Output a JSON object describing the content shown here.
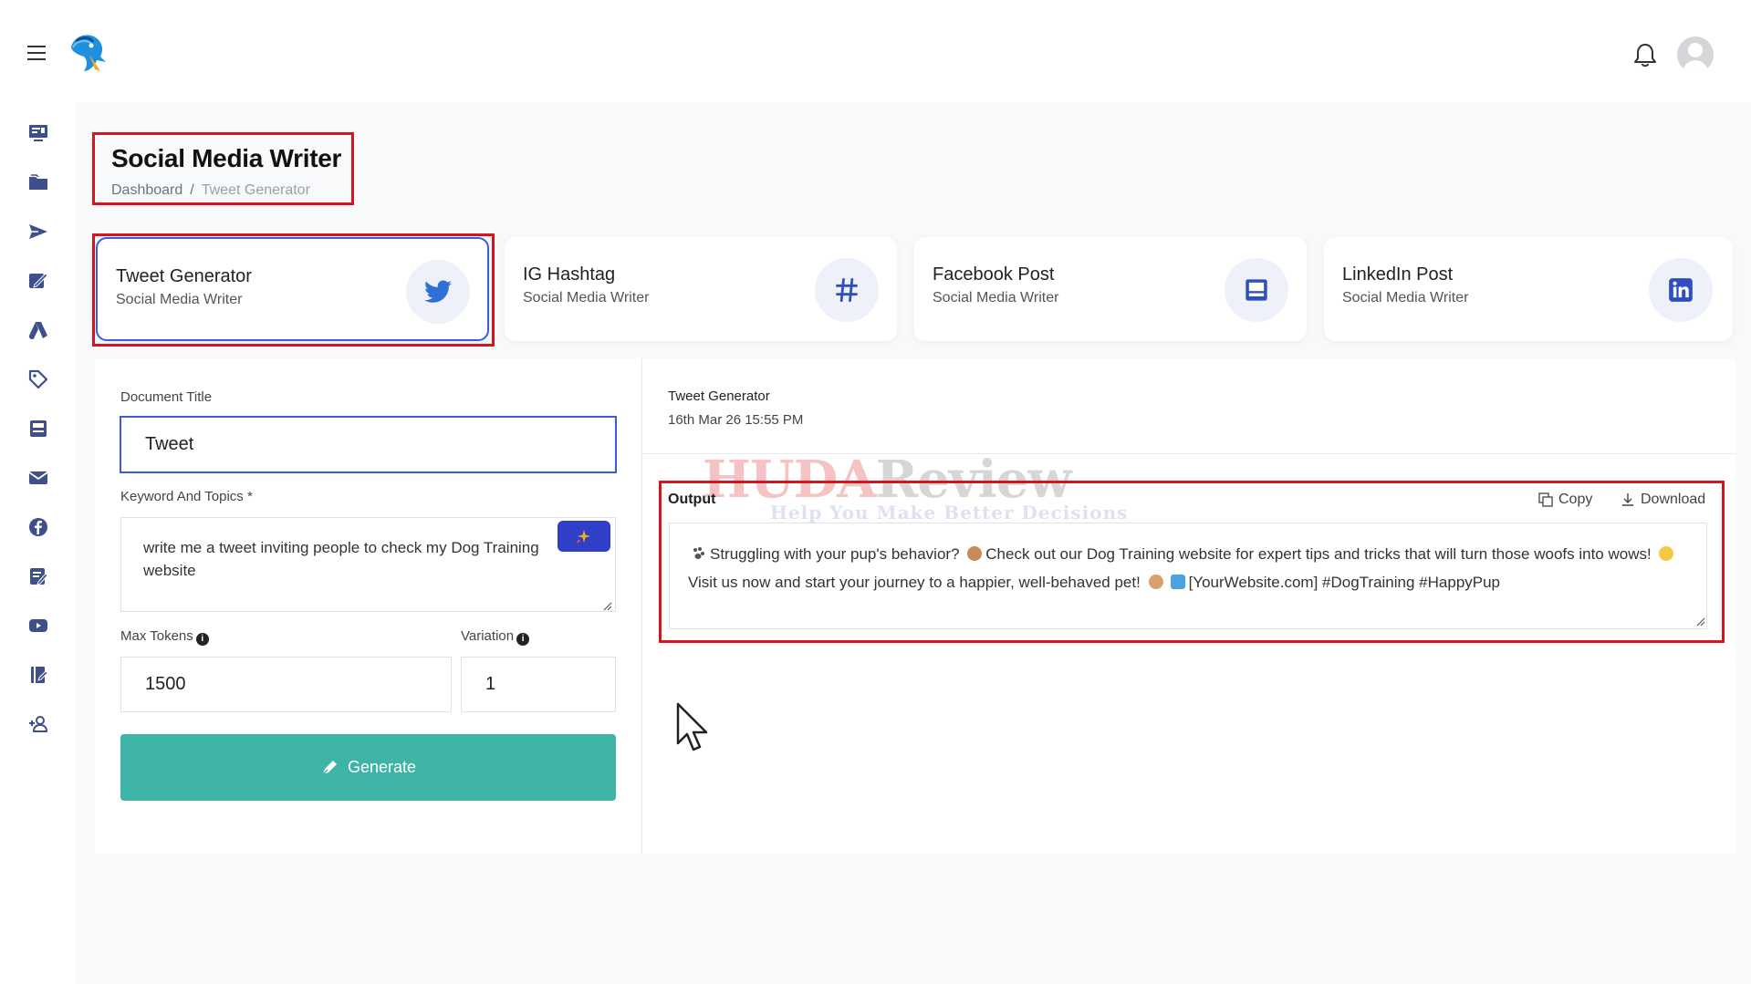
{
  "header": {
    "menu_icon": "hamburger-icon",
    "logo_icon": "bird-logo-icon",
    "notification_icon": "bell-icon",
    "avatar_icon": "user-avatar-icon"
  },
  "sidebar": {
    "items": [
      {
        "icon": "monitor-icon"
      },
      {
        "icon": "folder-icon"
      },
      {
        "icon": "send-icon"
      },
      {
        "icon": "edit-document-icon"
      },
      {
        "icon": "ads-icon"
      },
      {
        "icon": "tag-icon"
      },
      {
        "icon": "layout-icon"
      },
      {
        "icon": "mail-icon"
      },
      {
        "icon": "facebook-icon"
      },
      {
        "icon": "notes-icon"
      },
      {
        "icon": "youtube-icon"
      },
      {
        "icon": "book-icon"
      },
      {
        "icon": "add-user-icon"
      }
    ]
  },
  "page": {
    "title": "Social Media Writer",
    "breadcrumb": {
      "home": "Dashboard",
      "separator": "/",
      "current": "Tweet Generator"
    }
  },
  "cards": [
    {
      "title": "Tweet Generator",
      "subtitle": "Social Media Writer",
      "icon": "twitter-icon",
      "selected": true
    },
    {
      "title": "IG Hashtag",
      "subtitle": "Social Media Writer",
      "icon": "hashtag-icon",
      "selected": false
    },
    {
      "title": "Facebook Post",
      "subtitle": "Social Media Writer",
      "icon": "facebook-post-icon",
      "selected": false
    },
    {
      "title": "LinkedIn Post",
      "subtitle": "Social Media Writer",
      "icon": "linkedin-icon",
      "selected": false
    }
  ],
  "form": {
    "document_title_label": "Document Title",
    "document_title_value": "Tweet",
    "keywords_label": "Keyword And Topics *",
    "keywords_value": "write me a tweet inviting people to check my Dog Training website",
    "max_tokens_label": "Max Tokens",
    "max_tokens_value": "1500",
    "variation_label": "Variation",
    "variation_value": "1",
    "generate_label": "Generate"
  },
  "output": {
    "doc_name": "Tweet Generator",
    "date": "16th Mar 26 15:55 PM",
    "label": "Output",
    "copy_label": "Copy",
    "download_label": "Download",
    "text_part1": "Struggling with your pup's behavior?",
    "text_part2": "Check out our Dog Training website for expert tips and tricks that will turn those woofs into wows!",
    "text_part3": "Visit us now and start your journey to a happier, well-behaved pet!",
    "text_part4": "[YourWebsite.com] #DogTraining #HappyPup"
  },
  "watermark": {
    "main_a": "HUDA",
    "main_b": "Review",
    "sub": "Help You Make Better Decisions"
  },
  "colors": {
    "accent": "#3b5bdb",
    "generate_button": "#3db4a5",
    "highlight_red": "#d7141d",
    "magic_button": "#2f3fc7"
  }
}
